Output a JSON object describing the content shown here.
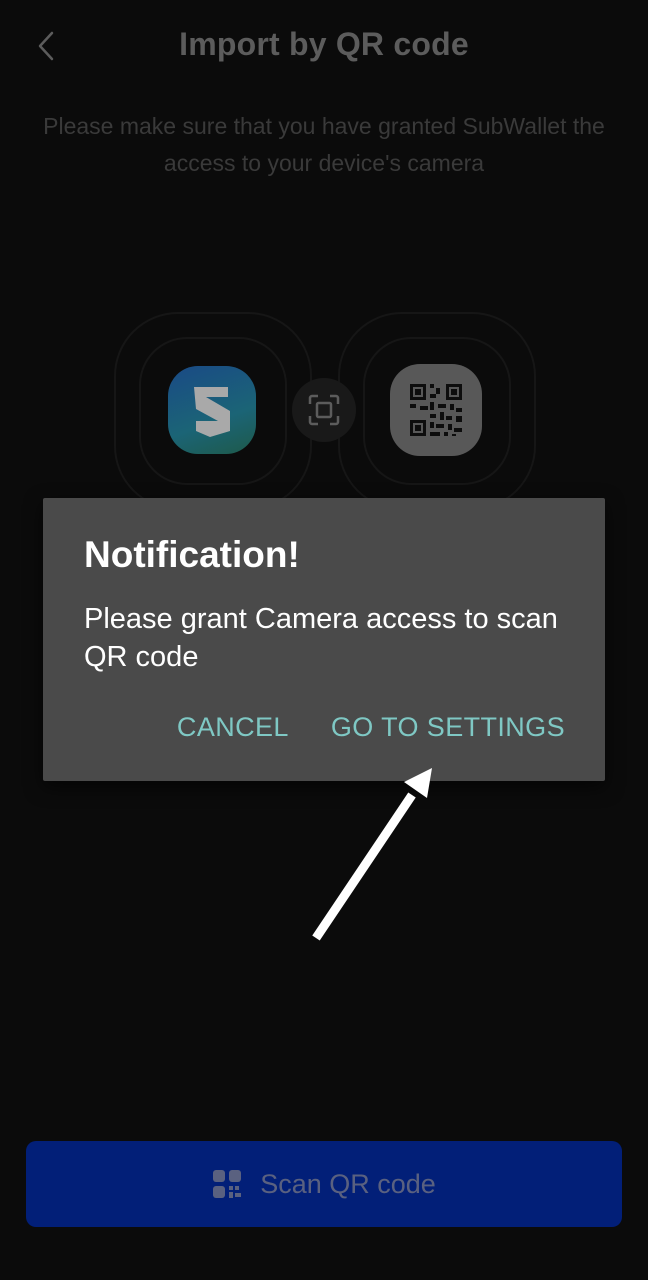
{
  "header": {
    "back_icon": "chevron-left-icon",
    "title": "Import by QR code"
  },
  "description": "Please make sure that you have granted SubWallet the access to your device's camera",
  "illustration": {
    "app_logo": "subwallet-logo-icon",
    "scan_icon": "scan-frame-icon",
    "qr_icon": "qr-code-icon"
  },
  "dialog": {
    "title": "Notification!",
    "message": "Please grant Camera access to scan QR code",
    "cancel_label": "CANCEL",
    "settings_label": "GO TO SETTINGS"
  },
  "footer": {
    "scan_button_label": "Scan QR code",
    "scan_button_icon": "qr-scan-icon"
  },
  "colors": {
    "background": "#0b0b0b",
    "dialog_bg": "#4a4a4a",
    "dialog_action": "#7fc8c4",
    "primary_button": "#021f78"
  }
}
